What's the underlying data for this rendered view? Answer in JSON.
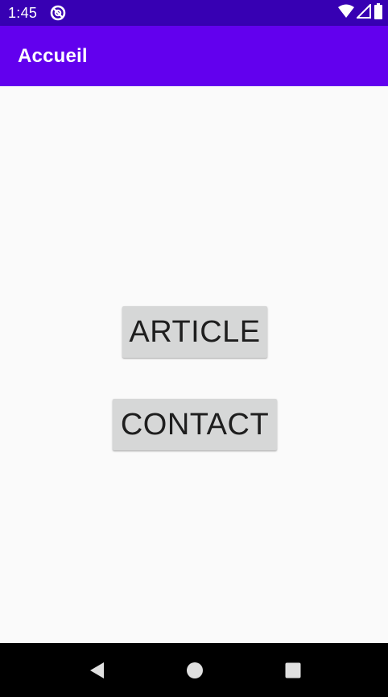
{
  "status_bar": {
    "time": "1:45",
    "icons": [
      "do-not-disturb-icon",
      "wifi-icon",
      "signal-icon",
      "battery-icon"
    ]
  },
  "toolbar": {
    "title": "Accueil",
    "color": "#6200ee"
  },
  "main": {
    "buttons": [
      {
        "label": "ARTICLE"
      },
      {
        "label": "CONTACT"
      }
    ]
  },
  "nav_bar": {
    "icons": [
      "back-icon",
      "home-icon",
      "recents-icon"
    ]
  },
  "colors": {
    "status_bar": "#3700b3",
    "toolbar": "#6200ee",
    "button_bg": "#d6d7d7",
    "background": "#fafafa"
  }
}
